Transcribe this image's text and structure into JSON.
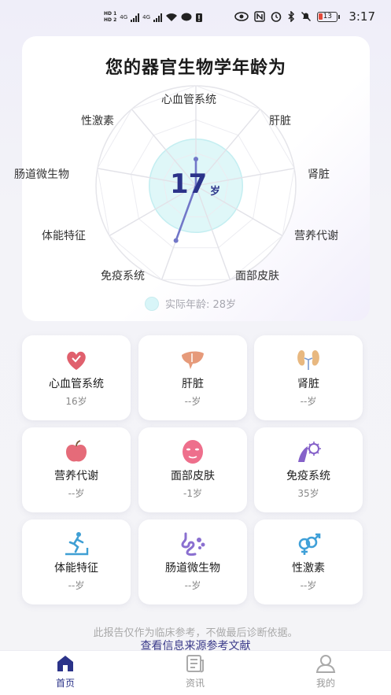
{
  "status_bar": {
    "hd1": "HD 1",
    "hd2": "HD 2",
    "net1": "4G",
    "net2": "4G",
    "battery": "13",
    "time": "3:17"
  },
  "radar": {
    "title": "您的器官生物学年龄为",
    "age_value": "17",
    "age_unit": "岁",
    "actual_age_label": "实际年龄: 28岁",
    "axes": [
      "心血管系统",
      "肝脏",
      "肾脏",
      "营养代谢",
      "面部皮肤",
      "免疫系统",
      "体能特征",
      "肠道微生物",
      "性激素"
    ],
    "values": [
      16,
      null,
      null,
      null,
      1,
      35,
      null,
      null,
      null
    ],
    "actual_age": 28
  },
  "organs": [
    {
      "name": "心血管系统",
      "age": "16岁",
      "icon": "heart-icon"
    },
    {
      "name": "肝脏",
      "age": "--岁",
      "icon": "liver-icon"
    },
    {
      "name": "肾脏",
      "age": "--岁",
      "icon": "kidney-icon"
    },
    {
      "name": "营养代谢",
      "age": "--岁",
      "icon": "apple-icon"
    },
    {
      "name": "面部皮肤",
      "age": "-1岁",
      "icon": "face-mask-icon"
    },
    {
      "name": "免疫系统",
      "age": "35岁",
      "icon": "immune-icon"
    },
    {
      "name": "体能特征",
      "age": "--岁",
      "icon": "treadmill-icon"
    },
    {
      "name": "肠道微生物",
      "age": "--岁",
      "icon": "intestine-icon"
    },
    {
      "name": "性激素",
      "age": "--岁",
      "icon": "gender-icon"
    }
  ],
  "footer": {
    "disclaimer": "此报告仅作为临床参考，不做最后诊断依据。",
    "reference_link": "查看信息来源参考文献"
  },
  "nav": {
    "home": "首页",
    "news": "资讯",
    "mine": "我的"
  },
  "colors": {
    "accent": "#2b3389",
    "radar_line": "#7277c8",
    "radar_fill": "#dff7f8",
    "heart": "#e0606d",
    "liver": "#e69a7a",
    "kidney": "#e8b880",
    "apple": "#e56b79",
    "face": "#ee6f8c",
    "immune": "#8561c9",
    "treadmill": "#3f9fd4",
    "intestine": "#8a6fd0",
    "gender": "#3fa0d8"
  }
}
